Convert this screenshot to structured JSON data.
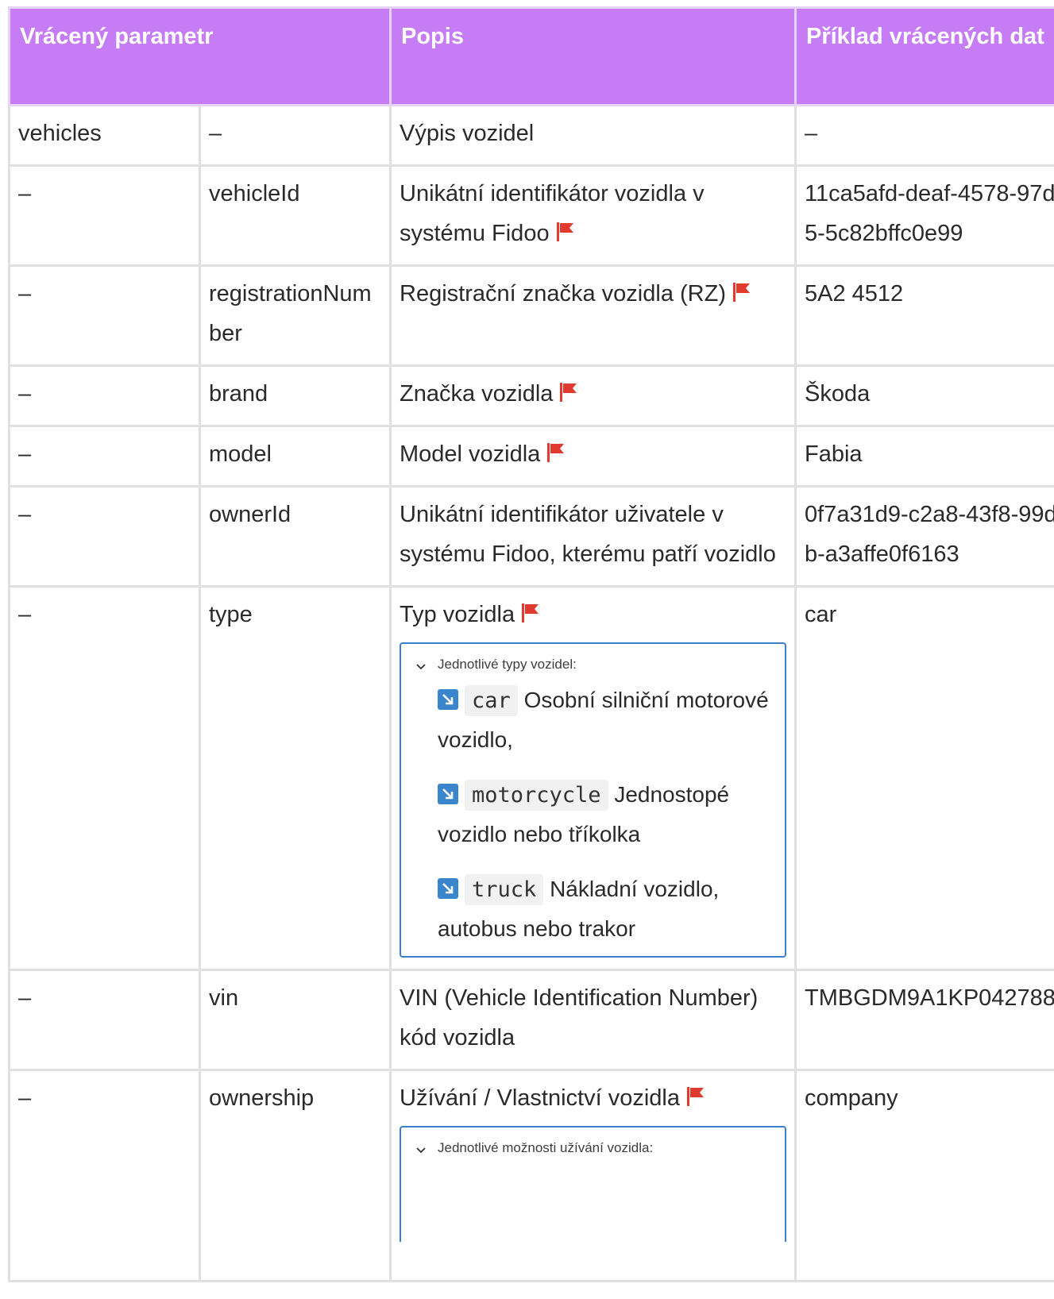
{
  "headers": [
    "Vrácený parametr",
    "Popis",
    "Příklad vrácených dat"
  ],
  "rows": [
    {
      "p1": "vehicles",
      "p2": "–",
      "desc": "Výpis vozidel",
      "example": "–",
      "flag": false
    },
    {
      "p1": "–",
      "p2": "vehicleId",
      "desc": "Unikátní identifikátor vozidla v systému Fidoo",
      "example": "11ca5afd-deaf-4578-97d5-5c82bffc0e99",
      "flag": true
    },
    {
      "p1": "–",
      "p2": "registrationNumber",
      "desc": "Registrační značka vozidla (RZ)",
      "example": "5A2 4512",
      "flag": true
    },
    {
      "p1": "–",
      "p2": "brand",
      "desc": "Značka vozidla",
      "example": "Škoda",
      "flag": true
    },
    {
      "p1": "–",
      "p2": "model",
      "desc": "Model vozidla",
      "example": "Fabia",
      "flag": true
    },
    {
      "p1": "–",
      "p2": "ownerId",
      "desc": "Unikátní identifikátor uživatele v systému Fidoo, kterému patří vozidlo",
      "example": "0f7a31d9-c2a8-43f8-99db-a3affe0f6163",
      "flag": false
    }
  ],
  "type_row": {
    "p1": "–",
    "p2": "type",
    "desc": "Typ vozidla",
    "example": "car",
    "expand_title": "Jednotlivé typy vozidel:",
    "items": [
      {
        "code": "car",
        "text": "Osobní silniční motorové vozidlo,"
      },
      {
        "code": "motorcycle",
        "text": "Jednostopé vozidlo nebo tříkolka"
      },
      {
        "code": "truck",
        "text": "Nákladní vozidlo, autobus nebo trakor"
      }
    ]
  },
  "vin_row": {
    "p1": "–",
    "p2": "vin",
    "desc": "VIN (Vehicle Identification Number) kód vozidla",
    "example": "TMBGDM9A1KP042788"
  },
  "ownership_row": {
    "p1": "–",
    "p2": "ownership",
    "desc": "Užívání / Vlastnictví vozidla",
    "example": "company",
    "expand_title": "Jednotlivé možnosti užívání vozidla:"
  },
  "colors": {
    "header_bg": "#c57cf5",
    "flag": "#e03b2e",
    "accent": "#3a7fd0"
  }
}
